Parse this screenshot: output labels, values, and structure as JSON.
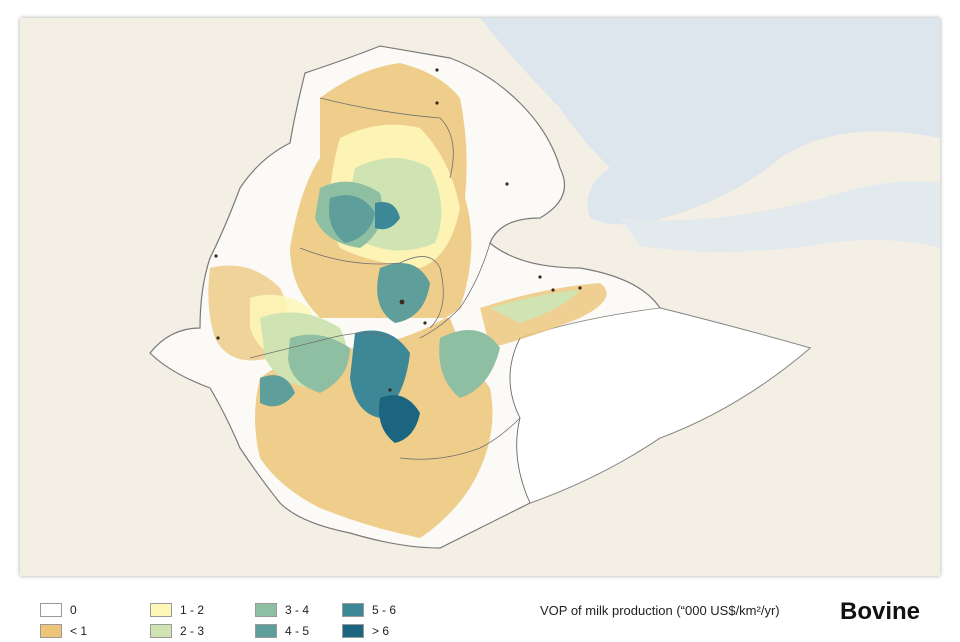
{
  "map": {
    "legend_title": "VOP of milk production (“000 US$/km²/yr)",
    "species": "Bovine",
    "classes": [
      {
        "label": "0",
        "color": "#ffffff"
      },
      {
        "label": "< 1",
        "color": "#ecc579"
      },
      {
        "label": "1 - 2",
        "color": "#fdf7b8"
      },
      {
        "label": "2 - 3",
        "color": "#cfe4b2"
      },
      {
        "label": "3 - 4",
        "color": "#8fbfa2"
      },
      {
        "label": "4 - 5",
        "color": "#5e9f9c"
      },
      {
        "label": "5 - 6",
        "color": "#3c8896"
      },
      {
        "label": "> 6",
        "color": "#1c6580"
      }
    ]
  }
}
